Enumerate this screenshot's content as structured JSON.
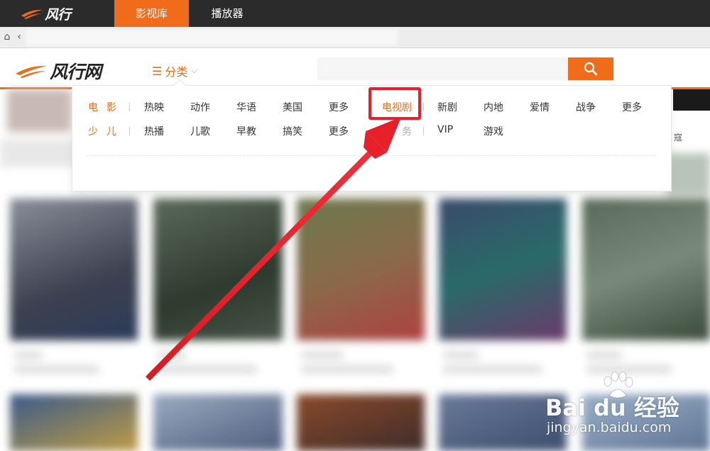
{
  "app": {
    "logo_text": "风行",
    "tabs": [
      {
        "label": "影视库",
        "active": true
      },
      {
        "label": "播放器",
        "active": false
      }
    ]
  },
  "site": {
    "logo_text": "风行网",
    "category_label": "分类",
    "hamburger_glyph": "☰",
    "chevron_glyph": "⌵"
  },
  "dropdown": {
    "rows": [
      {
        "heading": "电影",
        "items": [
          "热映",
          "动作",
          "华语",
          "美国",
          "更多",
          "电视剧",
          "新剧",
          "内地",
          "爱情",
          "战争",
          "更多"
        ]
      },
      {
        "heading": "少儿",
        "items": [
          "热播",
          "儿歌",
          "早教",
          "搞笑",
          "更多",
          "服务",
          "VIP",
          "游戏"
        ]
      }
    ],
    "highlighted_item": "电视剧"
  },
  "right_strip": {
    "partial_text": "寇"
  },
  "watermark": {
    "main": "Bai du 经验",
    "sub": "jingyan.baidu.com"
  },
  "colors": {
    "accent": "#f06b1a",
    "topbar": "#2b2b2b",
    "annotation": "#e8202a"
  }
}
